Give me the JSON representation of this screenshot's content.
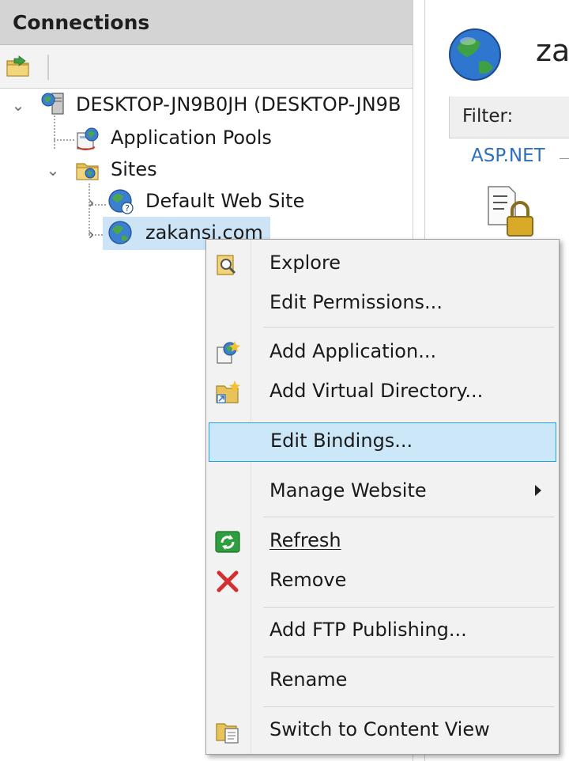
{
  "connections": {
    "title": "Connections",
    "tree": {
      "server": "DESKTOP-JN9B0JH (DESKTOP-JN9B",
      "app_pools": "Application Pools",
      "sites": "Sites",
      "default_site": "Default Web Site",
      "selected_site": "zakansi.com"
    }
  },
  "right_pane": {
    "title": "za",
    "filter_label": "Filter:",
    "group_label": "ASP.NET"
  },
  "context_menu": {
    "items": [
      {
        "label": "Explore",
        "icon": "explore-folder-icon"
      },
      {
        "label": "Edit Permissions...",
        "icon": ""
      },
      {
        "label": "Add Application...",
        "icon": "add-application-icon"
      },
      {
        "label": "Add Virtual Directory...",
        "icon": "add-virtual-directory-icon"
      },
      {
        "label": "Edit Bindings...",
        "icon": "",
        "highlighted": true
      },
      {
        "label": "Manage Website",
        "icon": "",
        "submenu": true
      },
      {
        "label": "Refresh",
        "icon": "refresh-icon"
      },
      {
        "label": "Remove",
        "icon": "remove-x-icon"
      },
      {
        "label": "Add FTP Publishing...",
        "icon": ""
      },
      {
        "label": "Rename",
        "icon": ""
      },
      {
        "label": "Switch to Content View",
        "icon": "content-view-icon"
      }
    ]
  },
  "colors": {
    "header_bg": "#d4d4d4",
    "selection_bg": "#cde4f7",
    "menu_bg": "#f2f2f2",
    "menu_highlight_bg": "#cce8f8",
    "menu_highlight_border": "#26a0da",
    "link_blue": "#2d6fbf",
    "remove_red": "#d32f2f"
  }
}
